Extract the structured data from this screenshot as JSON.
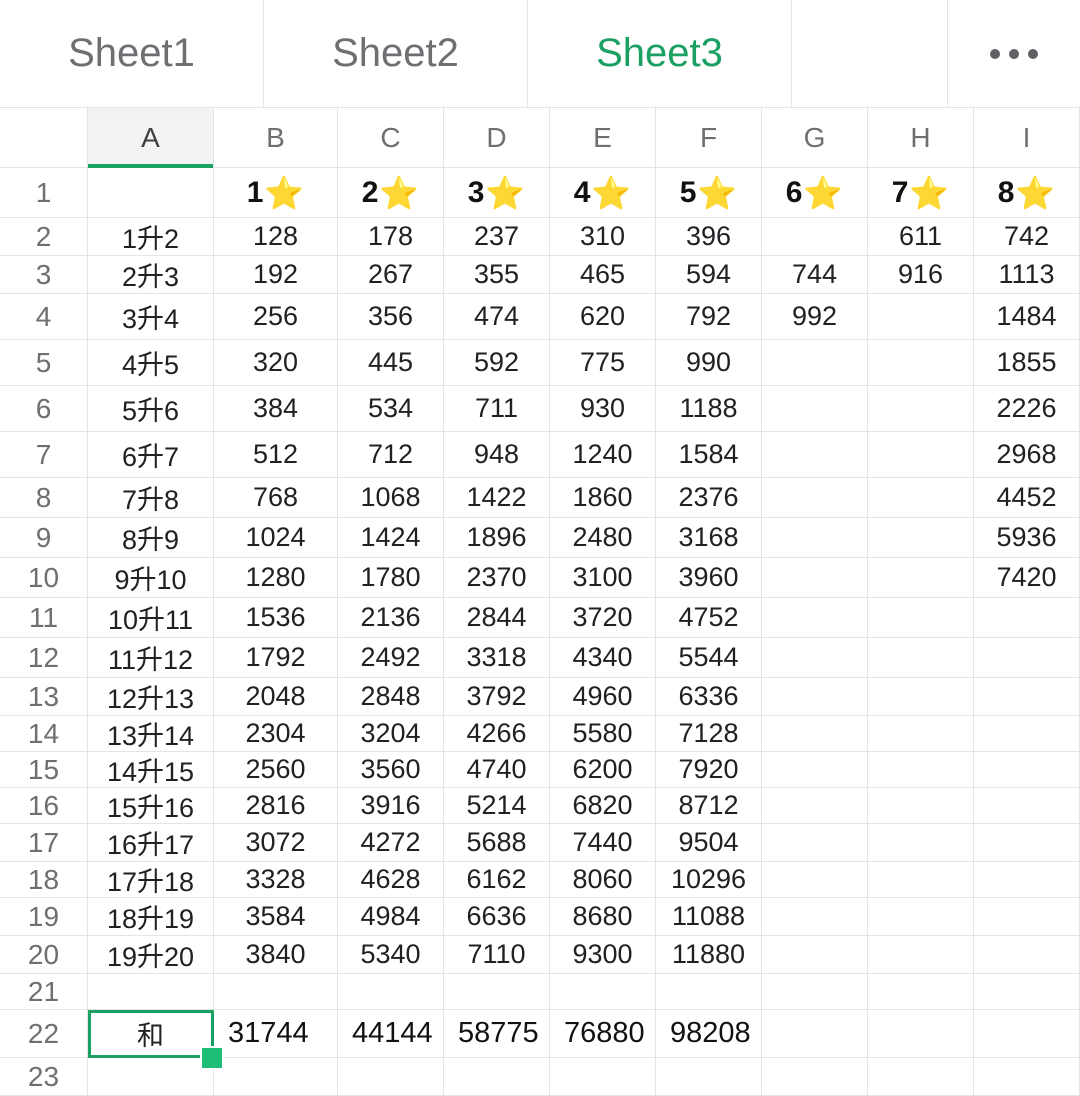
{
  "tabs": [
    {
      "label": "Sheet1",
      "active": false
    },
    {
      "label": "Sheet2",
      "active": false
    },
    {
      "label": "Sheet3",
      "active": true
    }
  ],
  "more_icon": "more-horizontal-icon",
  "accent_color": "#1aa062",
  "columns": [
    "A",
    "B",
    "C",
    "D",
    "E",
    "F",
    "G",
    "H",
    "I"
  ],
  "selected_column": "A",
  "selected_cell": "A22",
  "star_icon": "star-icon",
  "star_glyph": "⭐",
  "rows": [
    {
      "n": "1",
      "cells": [
        "",
        "1",
        "2",
        "3",
        "4",
        "5",
        "6",
        "7",
        "8"
      ]
    },
    {
      "n": "2",
      "cells": [
        "1升2",
        "128",
        "178",
        "237",
        "310",
        "396",
        "",
        "611",
        "742"
      ]
    },
    {
      "n": "3",
      "cells": [
        "2升3",
        "192",
        "267",
        "355",
        "465",
        "594",
        "744",
        "916",
        "1113"
      ]
    },
    {
      "n": "4",
      "cells": [
        "3升4",
        "256",
        "356",
        "474",
        "620",
        "792",
        "992",
        "",
        "1484"
      ]
    },
    {
      "n": "5",
      "cells": [
        "4升5",
        "320",
        "445",
        "592",
        "775",
        "990",
        "",
        "",
        "1855"
      ]
    },
    {
      "n": "6",
      "cells": [
        "5升6",
        "384",
        "534",
        "711",
        "930",
        "1188",
        "",
        "",
        "2226"
      ]
    },
    {
      "n": "7",
      "cells": [
        "6升7",
        "512",
        "712",
        "948",
        "1240",
        "1584",
        "",
        "",
        "2968"
      ]
    },
    {
      "n": "8",
      "cells": [
        "7升8",
        "768",
        "1068",
        "1422",
        "1860",
        "2376",
        "",
        "",
        "4452"
      ]
    },
    {
      "n": "9",
      "cells": [
        "8升9",
        "1024",
        "1424",
        "1896",
        "2480",
        "3168",
        "",
        "",
        "5936"
      ]
    },
    {
      "n": "10",
      "cells": [
        "9升10",
        "1280",
        "1780",
        "2370",
        "3100",
        "3960",
        "",
        "",
        "7420"
      ]
    },
    {
      "n": "11",
      "cells": [
        "10升11",
        "1536",
        "2136",
        "2844",
        "3720",
        "4752",
        "",
        "",
        ""
      ]
    },
    {
      "n": "12",
      "cells": [
        "11升12",
        "1792",
        "2492",
        "3318",
        "4340",
        "5544",
        "",
        "",
        ""
      ]
    },
    {
      "n": "13",
      "cells": [
        "12升13",
        "2048",
        "2848",
        "3792",
        "4960",
        "6336",
        "",
        "",
        ""
      ]
    },
    {
      "n": "14",
      "cells": [
        "13升14",
        "2304",
        "3204",
        "4266",
        "5580",
        "7128",
        "",
        "",
        ""
      ]
    },
    {
      "n": "15",
      "cells": [
        "14升15",
        "2560",
        "3560",
        "4740",
        "6200",
        "7920",
        "",
        "",
        ""
      ]
    },
    {
      "n": "16",
      "cells": [
        "15升16",
        "2816",
        "3916",
        "5214",
        "6820",
        "8712",
        "",
        "",
        ""
      ]
    },
    {
      "n": "17",
      "cells": [
        "16升17",
        "3072",
        "4272",
        "5688",
        "7440",
        "9504",
        "",
        "",
        ""
      ]
    },
    {
      "n": "18",
      "cells": [
        "17升18",
        "3328",
        "4628",
        "6162",
        "8060",
        "10296",
        "",
        "",
        ""
      ]
    },
    {
      "n": "19",
      "cells": [
        "18升19",
        "3584",
        "4984",
        "6636",
        "8680",
        "11088",
        "",
        "",
        ""
      ]
    },
    {
      "n": "20",
      "cells": [
        "19升20",
        "3840",
        "5340",
        "7110",
        "9300",
        "11880",
        "",
        "",
        ""
      ]
    },
    {
      "n": "21",
      "cells": [
        "",
        "",
        "",
        "",
        "",
        "",
        "",
        "",
        ""
      ]
    },
    {
      "n": "22",
      "cells": [
        "和",
        "31744",
        "44144",
        "58775",
        "76880",
        "98208",
        "",
        "",
        ""
      ]
    },
    {
      "n": "23",
      "cells": [
        "",
        "",
        "",
        "",
        "",
        "",
        "",
        "",
        ""
      ]
    }
  ]
}
